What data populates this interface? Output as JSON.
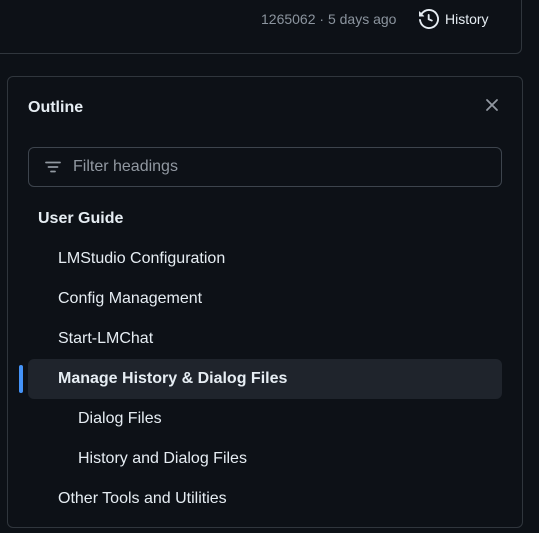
{
  "commit": {
    "meta": "1265062 · 5 days ago",
    "history_label": "History"
  },
  "outline": {
    "title": "Outline",
    "filter_placeholder": "Filter headings",
    "items": [
      {
        "label": "User Guide",
        "level": 1,
        "active": false
      },
      {
        "label": "LMStudio Configuration",
        "level": 2,
        "active": false
      },
      {
        "label": "Config Management",
        "level": 2,
        "active": false
      },
      {
        "label": "Start-LMChat",
        "level": 2,
        "active": false
      },
      {
        "label": "Manage History & Dialog Files",
        "level": 2,
        "active": true
      },
      {
        "label": "Dialog Files",
        "level": 3,
        "active": false
      },
      {
        "label": "History and Dialog Files",
        "level": 3,
        "active": false
      },
      {
        "label": "Other Tools and Utilities",
        "level": 2,
        "active": false
      }
    ]
  },
  "colors": {
    "background": "#0d1117",
    "border": "#30363d",
    "active_item_bg": "#1f242c",
    "active_marker": "#4493f8",
    "muted_text": "#8b949e"
  },
  "icons": {
    "history": "history-icon",
    "close": "close-icon",
    "filter": "filter-icon"
  }
}
